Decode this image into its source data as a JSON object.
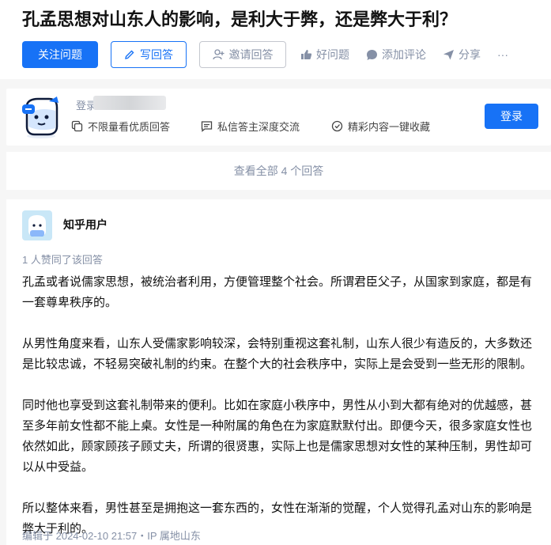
{
  "question": {
    "title": "孔孟思想对山东人的影响，是利大于弊，还是弊大于利？",
    "follow_label": "关注问题",
    "write_label": "写回答",
    "invite_label": "邀请回答",
    "like_label": "好问题",
    "comment_label": "添加评论",
    "share_label": "分享",
    "more_label": "···"
  },
  "banner": {
    "name_prefix": "登录",
    "features": [
      "不限量看优质回答",
      "私信答主深度交流",
      "精彩内容一键收藏"
    ],
    "login_label": "登录"
  },
  "view_all_label": "查看全部 4 个回答",
  "answer": {
    "author": "知乎用户",
    "vote_info": "1 人赞同了该回答",
    "paragraphs": [
      "孔孟或者说儒家思想，被统治者利用，方便管理整个社会。所谓君臣父子，从国家到家庭，都是有一套尊卑秩序的。",
      "从男性角度来看，山东人受儒家影响较深，会特别重视这套礼制，山东人很少有造反的，大多数还是比较忠诚，不轻易突破礼制的约束。在整个大的社会秩序中，实际上是会受到一些无形的限制。",
      "同时他也享受到这套礼制带来的便利。比如在家庭小秩序中，男性从小到大都有绝对的优越感，甚至多年前女性都不能上桌。女性是一种附属的角色在为家庭默默付出。即便今天，很多家庭女性也依然如此，顾家顾孩子顾丈夫，所谓的很贤惠，实际上也是儒家思想对女性的某种压制，男性却可以从中受益。",
      "所以整体来看，男性甚至是拥抱这一套东西的，女性在渐渐的觉醒，个人觉得孔孟对山东的影响是弊大于利的。"
    ],
    "edit_info": "编辑于 2024-02-10 21:57・IP 属地山东"
  },
  "colors": {
    "accent": "#1772f6",
    "muted": "#8590a6"
  }
}
